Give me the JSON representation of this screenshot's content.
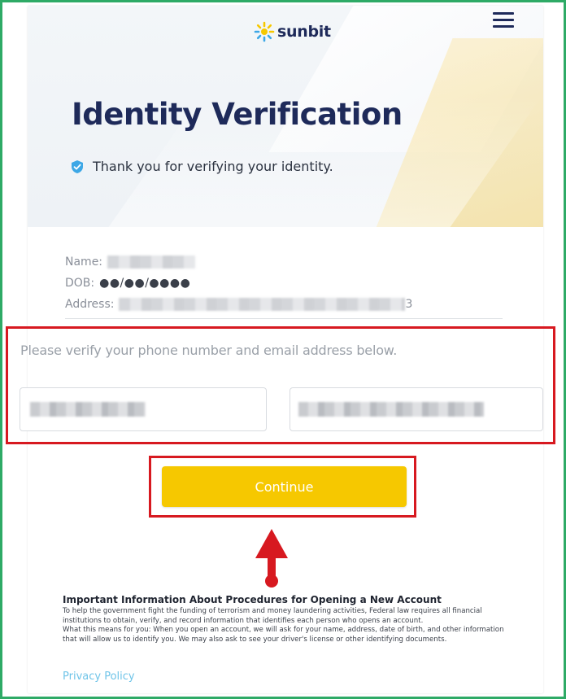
{
  "header": {
    "logo_text": "sunbit",
    "logo_icon": "sun-logo-icon",
    "menu_icon": "hamburger-menu-icon"
  },
  "hero": {
    "title": "Identity Verification",
    "verified_message": "Thank you for verifying your identity.",
    "verified_icon": "check-shield-icon"
  },
  "customer_info": {
    "name_label": "Name:",
    "dob_label": "DOB:",
    "dob_value": "●●/●●/●●●●",
    "address_label": "Address:",
    "address_tail": "3"
  },
  "verification": {
    "prompt": "Please verify your phone number and email address below."
  },
  "actions": {
    "continue_label": "Continue"
  },
  "legal": {
    "title": "Important Information About Procedures for Opening a New Account",
    "paragraph1": "To help the government fight the funding of terrorism and money laundering activities, Federal law requires all financial institutions to obtain, verify, and record information that identifies each person who opens an account.",
    "paragraph2": "What this means for you: When you open an account, we will ask for your name, address, date of birth, and other information that will allow us to identify you. We may also ask to see your driver's license or other identifying documents."
  },
  "footer": {
    "privacy_link": "Privacy Policy"
  },
  "colors": {
    "brand_navy": "#1e2a5a",
    "continue_yellow": "#f6c800",
    "highlight_red": "#d71920",
    "frame_green": "#2eaa66",
    "link_blue": "#6fc4e8",
    "check_blue": "#3ca7e6"
  }
}
